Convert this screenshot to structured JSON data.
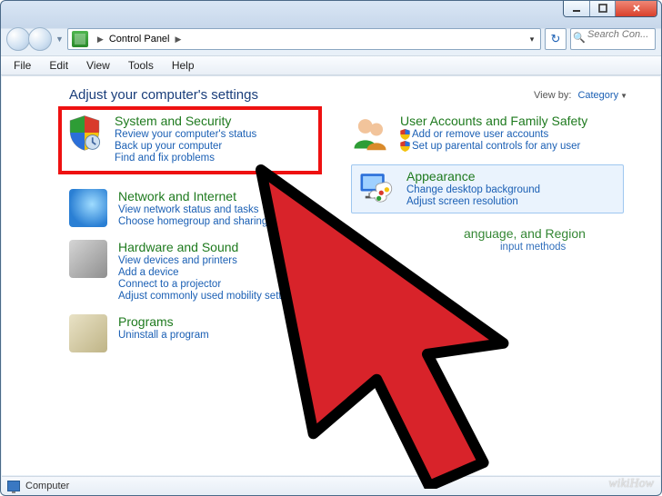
{
  "window": {
    "breadcrumb_root": "Control Panel",
    "search_placeholder": "Search Con..."
  },
  "menubar": [
    "File",
    "Edit",
    "View",
    "Tools",
    "Help"
  ],
  "header": {
    "title": "Adjust your computer's settings",
    "view_by_label": "View by:",
    "view_by_value": "Category"
  },
  "categories_left": [
    {
      "title": "System and Security",
      "links": [
        "Review your computer's status",
        "Back up your computer",
        "Find and fix problems"
      ],
      "highlight": true
    },
    {
      "title": "Network and Internet",
      "links": [
        "View network status and tasks",
        "Choose homegroup and sharing options"
      ]
    },
    {
      "title": "Hardware and Sound",
      "links": [
        "View devices and printers",
        "Add a device",
        "Connect to a projector",
        "Adjust commonly used mobility settings"
      ]
    },
    {
      "title": "Programs",
      "links": [
        "Uninstall a program"
      ]
    }
  ],
  "categories_right": [
    {
      "title": "User Accounts and Family Safety",
      "links": [
        {
          "label": "Add or remove user accounts",
          "shield": true
        },
        {
          "label": "Set up parental controls for any user",
          "shield": true
        }
      ]
    },
    {
      "title": "Appearance",
      "links": [
        "Change desktop background",
        "Adjust screen resolution"
      ],
      "selected": true
    },
    {
      "title_fragment_visible": "anguage, and Region",
      "links_fragment_visible": "input methods"
    }
  ],
  "status": {
    "label": "Computer"
  },
  "watermark": "wikiHow"
}
